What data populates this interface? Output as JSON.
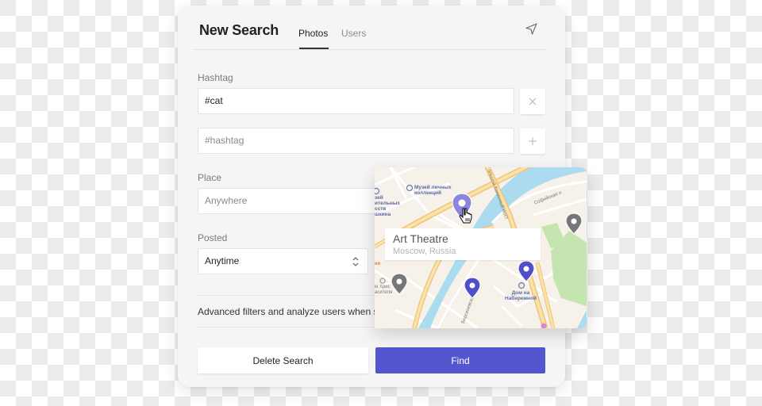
{
  "header": {
    "title": "New Search",
    "tabs": [
      {
        "label": "Photos",
        "active": true
      },
      {
        "label": "Users",
        "active": false
      }
    ],
    "send_icon": "send-icon"
  },
  "form": {
    "hashtag": {
      "label": "Hashtag",
      "rows": [
        {
          "value": "#cat",
          "action_icon": "close-icon"
        },
        {
          "value": "",
          "placeholder": "#hashtag",
          "action_icon": "plus-icon"
        }
      ]
    },
    "place": {
      "label": "Place",
      "value": "",
      "placeholder": "Anywhere"
    },
    "posted": {
      "label": "Posted",
      "selected": "Anytime",
      "icon": "chevron-updown-icon"
    },
    "advanced_text": "Advanced filters and analyze users when se"
  },
  "buttons": {
    "delete_label": "Delete Search",
    "find_label": "Find"
  },
  "map": {
    "popup": {
      "title": "Art Theatre",
      "subtitle": "Moscow, Russia"
    },
    "labels": {
      "museum_private": "Музей личных\nколлекций",
      "museum_fine_arts": "зей\nительных\nсств\nшкина",
      "bridge": "ольшой Каменный мост",
      "embankment_sofia": "Софийская н",
      "embankment_bers": "Берсеневская наб",
      "house_embankment": "Дом на\nНабережной",
      "cathedral": "м Хрис\nасителя",
      "orange_fragment": "ия"
    },
    "pins": [
      {
        "name": "selected-pin",
        "color": "#8a86dc"
      },
      {
        "name": "pin-gray-east",
        "color": "#777777"
      },
      {
        "name": "pin-gray-west",
        "color": "#777777"
      },
      {
        "name": "pin-blue-1",
        "color": "#4f4fc8"
      },
      {
        "name": "pin-blue-2",
        "color": "#4f4fc8"
      }
    ]
  },
  "colors": {
    "accent": "#5357cf",
    "card_bg": "#f5f5f5",
    "water": "#aadbef",
    "park": "#c5e5b0",
    "road": "#f6d68e"
  }
}
